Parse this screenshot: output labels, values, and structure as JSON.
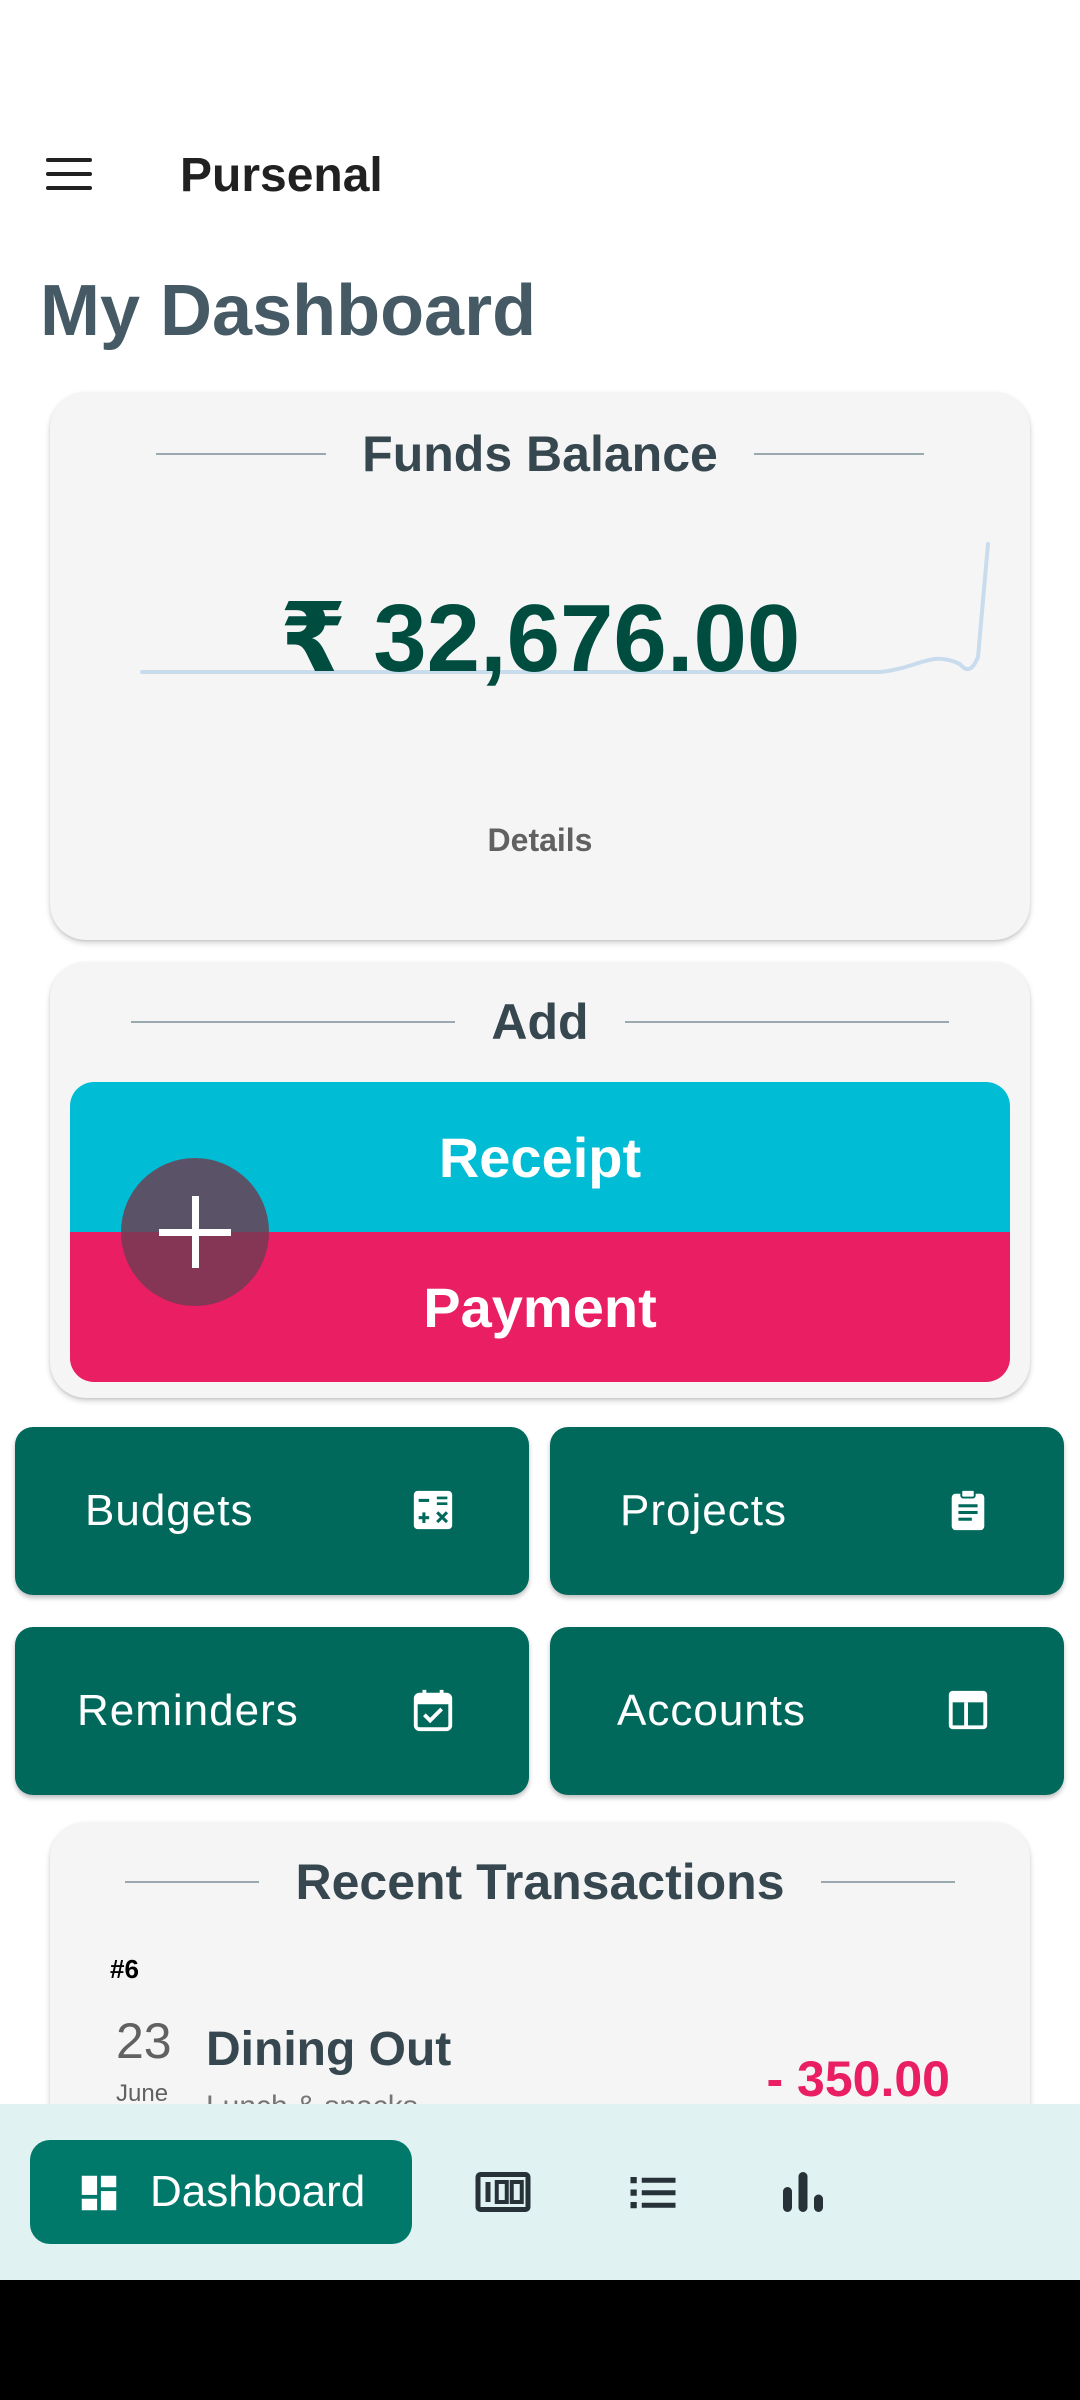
{
  "app": {
    "title": "Pursenal"
  },
  "page": {
    "title": "My Dashboard"
  },
  "funds": {
    "heading": "Funds Balance",
    "balance": "₹ 32,676.00",
    "details_label": "Details"
  },
  "add": {
    "heading": "Add",
    "receipt_label": "Receipt",
    "payment_label": "Payment"
  },
  "tiles": {
    "budgets": "Budgets",
    "projects": "Projects",
    "reminders": "Reminders",
    "accounts": "Accounts"
  },
  "recent": {
    "heading": "Recent Transactions",
    "items": [
      {
        "number": "#6",
        "day": "23",
        "month": "June",
        "category": "Dining Out",
        "subtitle": "Lunch & snacks",
        "amount": "- 350.00"
      }
    ]
  },
  "nav": {
    "dashboard_label": "Dashboard"
  },
  "colors": {
    "primary": "#00695c",
    "receipt": "#00bcd4",
    "payment": "#e91e63",
    "balance_text": "#004d40",
    "nav_background": "#e0f2f1"
  },
  "icons": [
    "menu-icon",
    "plus-icon",
    "calculator-icon",
    "clipboard-icon",
    "calendar-check-icon",
    "table-icon",
    "dashboard-icon",
    "counter-icon",
    "list-icon",
    "bar-chart-icon"
  ]
}
